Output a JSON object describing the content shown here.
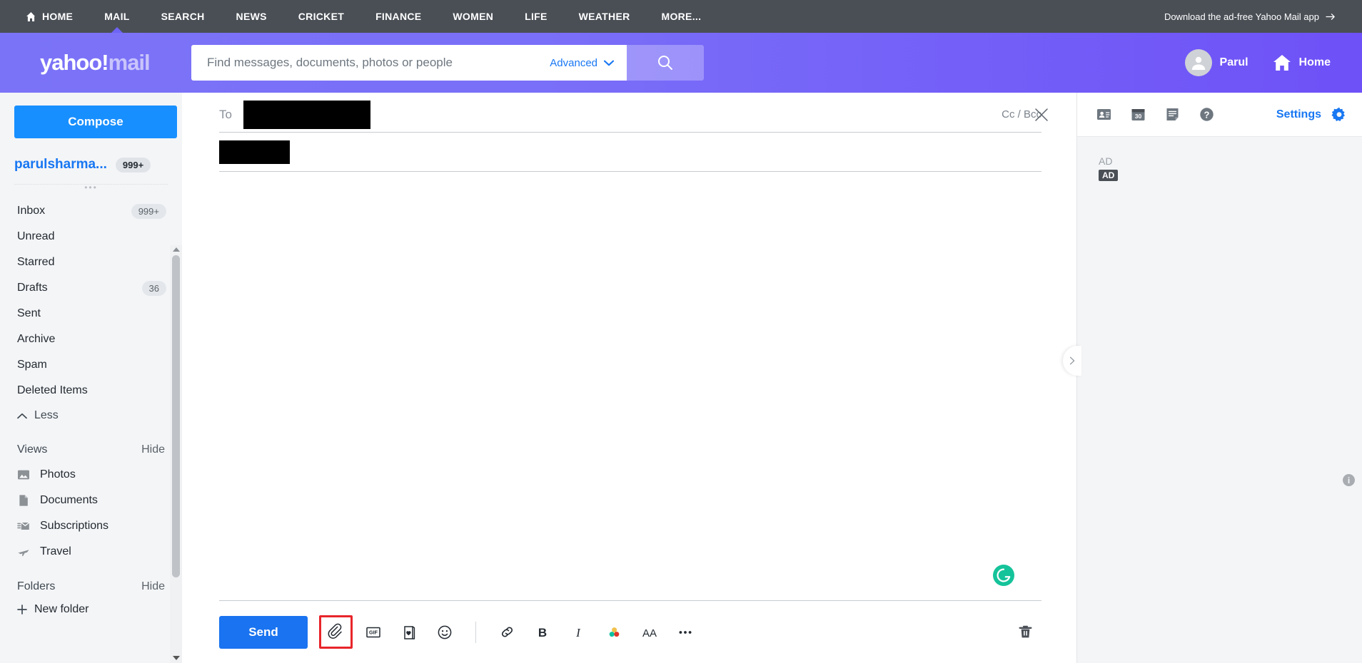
{
  "topnav": {
    "items": [
      {
        "label": "HOME",
        "icon": "home-icon",
        "active": false
      },
      {
        "label": "MAIL",
        "icon": "",
        "active": true
      },
      {
        "label": "SEARCH",
        "icon": "",
        "active": false
      },
      {
        "label": "NEWS",
        "icon": "",
        "active": false
      },
      {
        "label": "CRICKET",
        "icon": "",
        "active": false
      },
      {
        "label": "FINANCE",
        "icon": "",
        "active": false
      },
      {
        "label": "WOMEN",
        "icon": "",
        "active": false
      },
      {
        "label": "LIFE",
        "icon": "",
        "active": false
      },
      {
        "label": "WEATHER",
        "icon": "",
        "active": false
      },
      {
        "label": "MORE...",
        "icon": "",
        "active": false
      }
    ],
    "promo": "Download the ad-free Yahoo Mail app",
    "promo_icon": "arrow-right-icon",
    "background": "#4a4f56"
  },
  "header": {
    "logo": {
      "part1": "yahoo",
      "part2": "!",
      "part3": "mail"
    },
    "search": {
      "placeholder": "Find messages, documents, photos or people",
      "value": "",
      "advanced_label": "Advanced",
      "advanced_icon": "chevron-down-icon",
      "search_icon": "search-icon"
    },
    "profile": {
      "name": "Parul",
      "icon": "avatar-icon"
    },
    "home": {
      "label": "Home",
      "icon": "home-icon"
    },
    "accent": "#6e64f5"
  },
  "sidebar": {
    "compose_label": "Compose",
    "account": {
      "name": "parulsharma...",
      "badge": "999+"
    },
    "folders": [
      {
        "label": "Inbox",
        "badge": "999+"
      },
      {
        "label": "Unread",
        "badge": ""
      },
      {
        "label": "Starred",
        "badge": ""
      },
      {
        "label": "Drafts",
        "badge": "36"
      },
      {
        "label": "Sent",
        "badge": ""
      },
      {
        "label": "Archive",
        "badge": ""
      },
      {
        "label": "Spam",
        "badge": ""
      },
      {
        "label": "Deleted Items",
        "badge": ""
      }
    ],
    "less_label": "Less",
    "less_icon": "chevron-up-icon",
    "views": {
      "title": "Views",
      "action": "Hide",
      "items": [
        {
          "label": "Photos",
          "icon": "photos-icon"
        },
        {
          "label": "Documents",
          "icon": "documents-icon"
        },
        {
          "label": "Subscriptions",
          "icon": "subscriptions-icon"
        },
        {
          "label": "Travel",
          "icon": "travel-icon"
        }
      ]
    },
    "folders_section": {
      "title": "Folders",
      "action": "Hide"
    },
    "new_folder": {
      "label": "New folder",
      "icon": "plus-icon"
    }
  },
  "compose": {
    "close_icon": "close-icon",
    "to_label": "To",
    "to_value": "",
    "ccbcc_label": "Cc / Bcc",
    "subject_value": "",
    "body_value": "",
    "grammarly_icon": "grammarly-icon",
    "toolbar": {
      "send_label": "Send",
      "buttons": [
        {
          "name": "attach-icon",
          "label": "Attach files",
          "highlighted": true
        },
        {
          "name": "gif-icon",
          "label": "GIF",
          "highlighted": false
        },
        {
          "name": "greeting-card-icon",
          "label": "Greeting card",
          "highlighted": false
        },
        {
          "name": "emoji-icon",
          "label": "Emoji",
          "highlighted": false
        },
        {
          "name": "link-icon",
          "label": "Insert link",
          "highlighted": false
        },
        {
          "name": "bold-icon",
          "label": "B",
          "highlighted": false
        },
        {
          "name": "italic-icon",
          "label": "I",
          "highlighted": false
        },
        {
          "name": "text-color-icon",
          "label": "Text color",
          "highlighted": false
        },
        {
          "name": "font-size-icon",
          "label": "AA",
          "highlighted": false
        },
        {
          "name": "more-options-icon",
          "label": "More options",
          "highlighted": false
        }
      ],
      "trash": {
        "name": "trash-icon",
        "label": "Discard draft"
      }
    },
    "highlight_color": "#e8252a"
  },
  "rail": {
    "icons": [
      {
        "name": "contacts-icon",
        "label": "Contacts"
      },
      {
        "name": "calendar-icon",
        "label": "Calendar",
        "text": "30"
      },
      {
        "name": "notepad-icon",
        "label": "Notepad"
      },
      {
        "name": "help-icon",
        "label": "Help"
      }
    ],
    "settings_label": "Settings",
    "settings_icon": "gear-icon",
    "ad_text": "AD",
    "ad_badge": "AD",
    "expand_icon": "chevron-right-icon",
    "info_icon": "info-icon",
    "info_glyph": "i"
  }
}
